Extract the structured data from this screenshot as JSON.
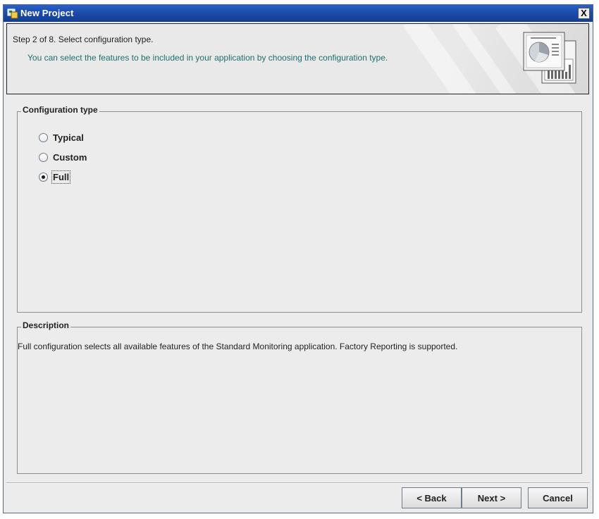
{
  "window": {
    "title": "New Project",
    "close_label": "X"
  },
  "header": {
    "step": "Step 2 of 8. Select configuration type.",
    "description": "You can select the features to be included in your application by choosing the configuration type.",
    "art_icon": "report-chart-icon"
  },
  "config": {
    "legend": "Configuration type",
    "options": [
      {
        "label": "Typical",
        "checked": false
      },
      {
        "label": "Custom",
        "checked": false
      },
      {
        "label": "Full",
        "checked": true
      }
    ]
  },
  "description_panel": {
    "legend": "Description",
    "text": "Full configuration selects all available features of the Standard Monitoring application. Factory Reporting is supported."
  },
  "buttons": {
    "back": "< Back",
    "next": "Next >",
    "cancel": "Cancel"
  },
  "colors": {
    "titlebar": "#1a4aa8",
    "description_text": "#1f6f6f",
    "background": "#ececec"
  }
}
